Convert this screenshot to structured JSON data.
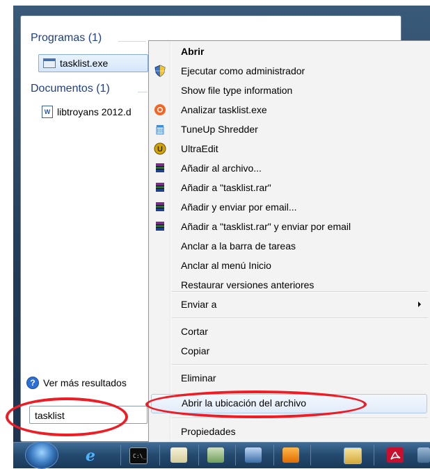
{
  "start_menu": {
    "programs_header": "Programas (1)",
    "program_result": "tasklist.exe",
    "documents_header": "Documentos (1)",
    "document_result": "libtroyans 2012.d",
    "see_more": "Ver más resultados",
    "search_value": "tasklist"
  },
  "context_menu": {
    "items": [
      {
        "label": "Abrir",
        "icon": "none",
        "bold": true
      },
      {
        "label": "Ejecutar como administrador",
        "icon": "uac-shield-icon"
      },
      {
        "label": "Show file type information",
        "icon": "none"
      },
      {
        "label": "Analizar tasklist.exe",
        "icon": "avast-icon"
      },
      {
        "label": "TuneUp Shredder",
        "icon": "shredder-icon"
      },
      {
        "label": "UltraEdit",
        "icon": "ultraedit-icon"
      },
      {
        "label": "Añadir al archivo...",
        "icon": "winrar-icon"
      },
      {
        "label": "Añadir a \"tasklist.rar\"",
        "icon": "winrar-icon"
      },
      {
        "label": "Añadir y enviar por email...",
        "icon": "winrar-icon"
      },
      {
        "label": "Añadir a \"tasklist.rar\" y enviar por email",
        "icon": "winrar-icon"
      },
      {
        "label": "Anclar a la barra de tareas",
        "icon": "none"
      },
      {
        "label": "Anclar al menú Inicio",
        "icon": "none"
      },
      {
        "label": "Restaurar versiones anteriores",
        "icon": "none"
      },
      {
        "label": "Enviar a",
        "icon": "none",
        "submenu": true
      },
      {
        "label": "Cortar",
        "icon": "none"
      },
      {
        "label": "Copiar",
        "icon": "none"
      },
      {
        "label": "Eliminar",
        "icon": "none"
      },
      {
        "label": "Abrir la ubicación del archivo",
        "icon": "none",
        "highlighted": true
      },
      {
        "label": "Propiedades",
        "icon": "none"
      }
    ]
  },
  "taskbar": {
    "icons": [
      "start-orb-icon",
      "internet-explorer-icon",
      "cmd-icon",
      "file-icon",
      "network-icon",
      "remote-desktop-icon",
      "media-player-icon",
      "explorer-icon",
      "acrobat-icon",
      "app-icon"
    ]
  },
  "colors": {
    "annotation": "#ee1c24",
    "header_blue": "#1e3e8a",
    "highlight_border": "#aecbee"
  }
}
